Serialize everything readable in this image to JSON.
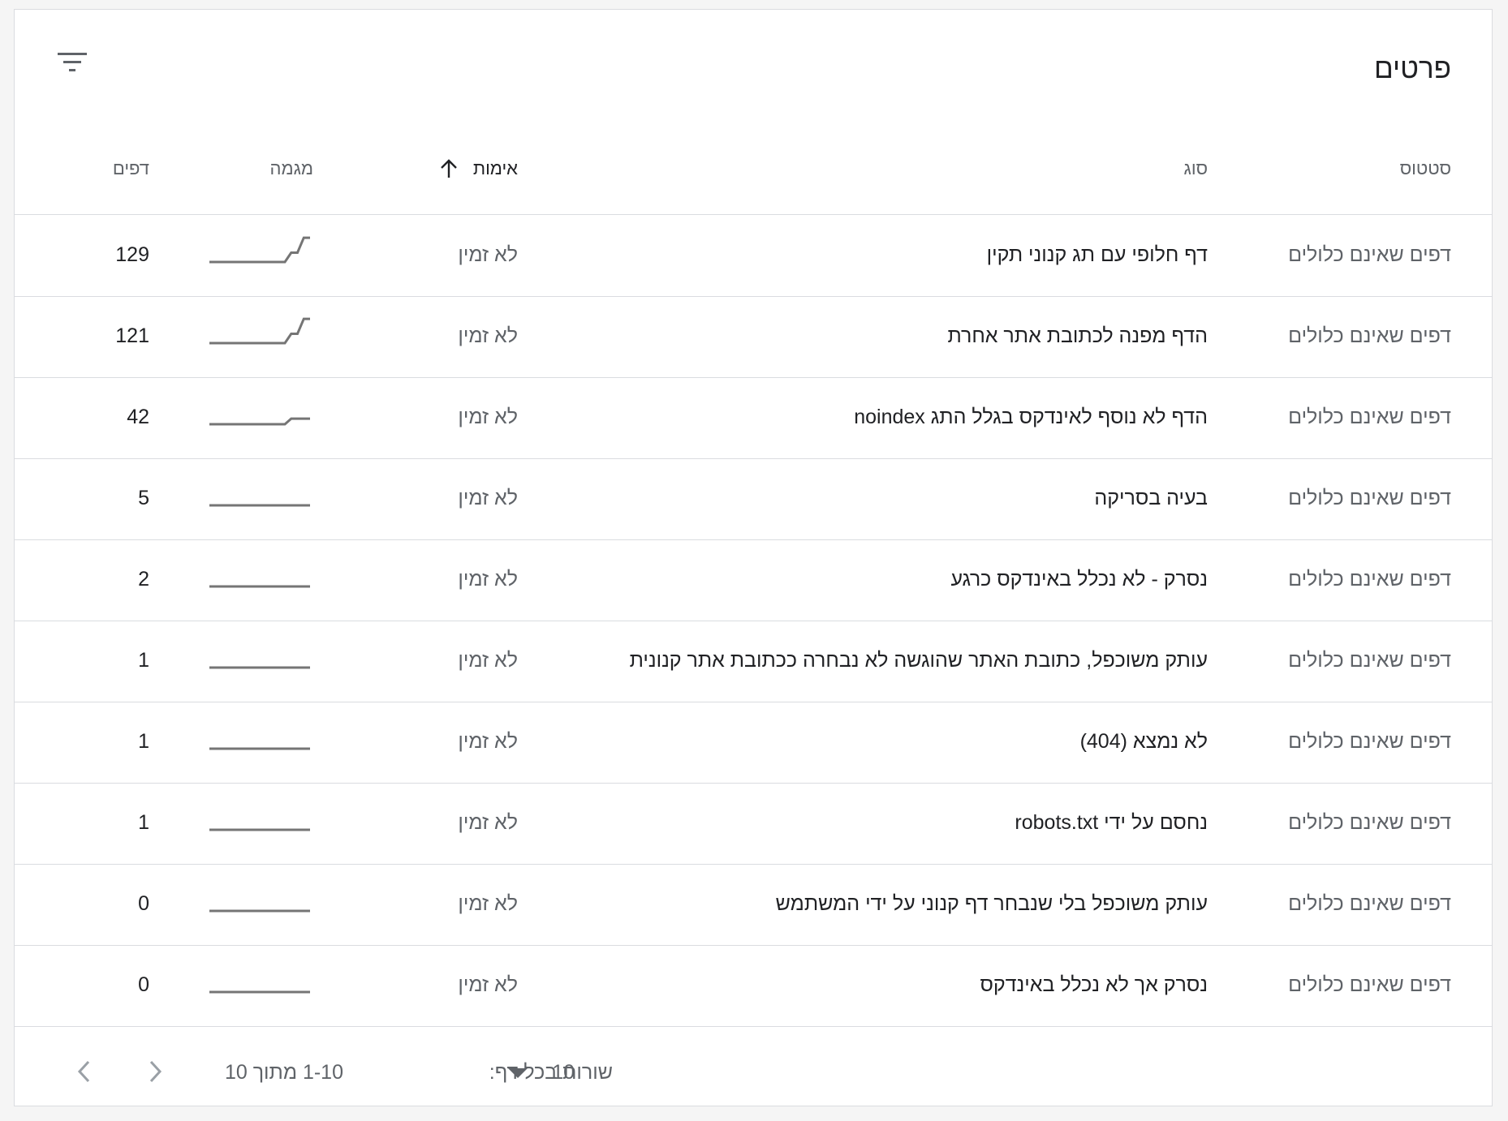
{
  "card": {
    "title": "פרטים"
  },
  "table": {
    "headers": {
      "status": "סטטוס",
      "type": "סוג",
      "verification": "אימות",
      "trend": "מגמה",
      "pages": "דפים"
    },
    "sort": {
      "column": "verification",
      "direction": "ascending",
      "icon": "arrow-up-icon"
    },
    "rows": [
      {
        "status": "דפים שאינם כלולים",
        "type": "דף חלופי עם תג קנוני תקין",
        "verification": "לא זמין",
        "trend": [
          0,
          0,
          0,
          0,
          0,
          0,
          0,
          0,
          0,
          0,
          0,
          0,
          0,
          1,
          1,
          2.6,
          2.6
        ],
        "pages": "129"
      },
      {
        "status": "דפים שאינם כלולים",
        "type": "הדף מפנה לכתובת אתר אחרת",
        "verification": "לא זמין",
        "trend": [
          0,
          0,
          0,
          0,
          0,
          0,
          0,
          0,
          0,
          0,
          0,
          0,
          0,
          1,
          1,
          2.6,
          2.6
        ],
        "pages": "121"
      },
      {
        "status": "דפים שאינם כלולים",
        "type": "הדף לא נוסף לאינדקס בגלל התג noindex",
        "verification": "לא זמין",
        "trend": [
          0,
          0,
          0,
          0,
          0,
          0,
          0,
          0,
          0,
          0,
          0,
          0,
          0,
          0.6,
          0.6,
          0.6,
          0.6
        ],
        "pages": "42"
      },
      {
        "status": "דפים שאינם כלולים",
        "type": "בעיה בסריקה",
        "verification": "לא זמין",
        "trend": [
          0,
          0,
          0,
          0,
          0,
          0,
          0,
          0,
          0,
          0,
          0,
          0,
          0,
          0,
          0,
          0,
          0
        ],
        "pages": "5"
      },
      {
        "status": "דפים שאינם כלולים",
        "type": "נסרק - לא נכלל באינדקס כרגע",
        "verification": "לא זמין",
        "trend": [
          0,
          0,
          0,
          0,
          0,
          0,
          0,
          0,
          0,
          0,
          0,
          0,
          0,
          0,
          0,
          0,
          0
        ],
        "pages": "2"
      },
      {
        "status": "דפים שאינם כלולים",
        "type": "עותק משוכפל, כתובת האתר שהוגשה לא נבחרה ככתובת אתר קנונית",
        "verification": "לא זמין",
        "trend": [
          0,
          0,
          0,
          0,
          0,
          0,
          0,
          0,
          0,
          0,
          0,
          0,
          0,
          0,
          0,
          0,
          0
        ],
        "pages": "1"
      },
      {
        "status": "דפים שאינם כלולים",
        "type": "לא נמצא (404)",
        "verification": "לא זמין",
        "trend": [
          0,
          0,
          0,
          0,
          0,
          0,
          0,
          0,
          0,
          0,
          0,
          0,
          0,
          0,
          0,
          0,
          0
        ],
        "pages": "1"
      },
      {
        "status": "דפים שאינם כלולים",
        "type": "נחסם על ידי robots.txt",
        "verification": "לא זמין",
        "trend": [
          0,
          0,
          0,
          0,
          0,
          0,
          0,
          0,
          0,
          0,
          0,
          0,
          0,
          0,
          0,
          0,
          0
        ],
        "pages": "1"
      },
      {
        "status": "דפים שאינם כלולים",
        "type": "עותק משוכפל בלי שנבחר דף קנוני על ידי המשתמש",
        "verification": "לא זמין",
        "trend": [
          0,
          0,
          0,
          0,
          0,
          0,
          0,
          0,
          0,
          0,
          0,
          0,
          0,
          0,
          0,
          0,
          0
        ],
        "pages": "0"
      },
      {
        "status": "דפים שאינם כלולים",
        "type": "נסרק אך לא נכלל באינדקס",
        "verification": "לא זמין",
        "trend": [
          0,
          0,
          0,
          0,
          0,
          0,
          0,
          0,
          0,
          0,
          0,
          0,
          0,
          0,
          0,
          0,
          0
        ],
        "pages": "0"
      }
    ]
  },
  "pagination": {
    "rows_per_page_label": "שורות בכל דף:",
    "rows_per_page_value": "10",
    "range_text": "1-10 מתוך 10"
  },
  "icons": {
    "filter": "filter-icon",
    "sort": "arrow-up-icon",
    "dropdown": "dropdown-triangle-icon",
    "prev": "chevron-left-icon",
    "next": "chevron-right-icon"
  },
  "colors": {
    "line": "#757575",
    "text_primary": "#202124",
    "text_secondary": "#5f6368",
    "divider": "#dadce0"
  }
}
